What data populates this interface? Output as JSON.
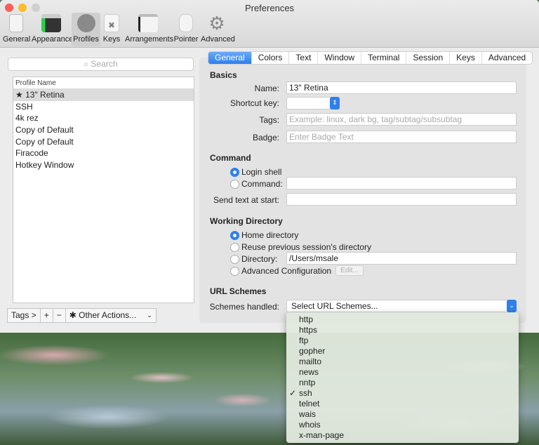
{
  "window": {
    "title": "Preferences"
  },
  "toolbar": [
    "General",
    "Appearance",
    "Profiles",
    "Keys",
    "Arrangements",
    "Pointer",
    "Advanced"
  ],
  "search_placeholder": "Search",
  "profiles": {
    "header": "Profile Name",
    "items": [
      "★ 13\" Retina",
      "SSH",
      "4k rez",
      "Copy of Default",
      "Copy of Default",
      "Firacode",
      "Hotkey Window"
    ]
  },
  "bottom": {
    "tags": "Tags >",
    "plus": "+",
    "minus": "−",
    "other": "Other Actions...",
    "gear": "✱"
  },
  "tabs": [
    "General",
    "Colors",
    "Text",
    "Window",
    "Terminal",
    "Session",
    "Keys",
    "Advanced"
  ],
  "basics": {
    "heading": "Basics",
    "name_label": "Name:",
    "name_value": "13\" Retina",
    "shortcut_label": "Shortcut key:",
    "tags_label": "Tags:",
    "tags_placeholder": "Example: linux, dark bg, tag/subtag/subsubtag",
    "badge_label": "Badge:",
    "badge_placeholder": "Enter Badge Text"
  },
  "command": {
    "heading": "Command",
    "login": "Login shell",
    "command": "Command:",
    "send_label": "Send text at start:"
  },
  "workdir": {
    "heading": "Working Directory",
    "home": "Home directory",
    "reuse": "Reuse previous session's directory",
    "directory": "Directory:",
    "directory_value": "/Users/msale",
    "advanced": "Advanced Configuration",
    "edit": "Edit..."
  },
  "url": {
    "heading": "URL Schemes",
    "label": "Schemes handled:",
    "value": "Select URL Schemes...",
    "options": [
      "http",
      "https",
      "ftp",
      "gopher",
      "mailto",
      "news",
      "nntp",
      "ssh",
      "telnet",
      "wais",
      "whois",
      "x-man-page"
    ],
    "checked": "ssh",
    "checkmark": "✓"
  }
}
